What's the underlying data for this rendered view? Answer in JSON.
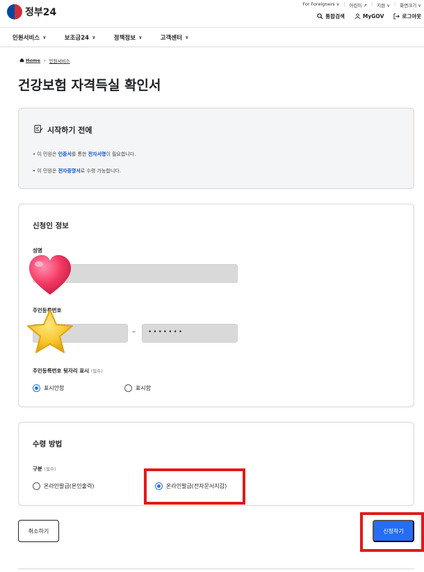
{
  "header": {
    "logo_text": "정부24",
    "util_links": [
      "For Foreigners ∨",
      "어린이 ↗",
      "지원 ∨",
      "화면크기 ∨"
    ],
    "search_label": "통합검색",
    "mygov_label": "MyGOV",
    "logout_label": "로그아웃"
  },
  "gnb": {
    "items": [
      "민원서비스",
      "보조금24",
      "정책정보",
      "고객센터"
    ]
  },
  "breadcrumb": {
    "home": "Home",
    "current": "민원서비스"
  },
  "page_title": "건강보험 자격득실 확인서",
  "notice": {
    "title": "시작하기 전에",
    "line1_pre": "• 이 민원은 ",
    "line1_b1": "인증서",
    "line1_mid": "를 통한 ",
    "line1_b2": "전자서명",
    "line1_post": "이 필요합니다.",
    "line2_pre": "• 이 민원은 ",
    "line2_b1": "전자증명서",
    "line2_post": "로 수령 가능합니다."
  },
  "applicant": {
    "title": "신청인 정보",
    "name_label": "성명",
    "rrn_label": "주민등록번호",
    "rrn_back_value": "•••••••",
    "rrn_dash": "–",
    "display_label": "주민등록번호 뒷자리 표시",
    "required": "(필수)",
    "option_hide": "표시안함",
    "option_show": "표시함"
  },
  "receive": {
    "title": "수령 방법",
    "type_label": "구분",
    "required": "(필수)",
    "option_print": "온라인발급(본인출력)",
    "option_wallet": "온라인발급(전자문서지갑)"
  },
  "buttons": {
    "cancel": "취소하기",
    "submit": "신청하기"
  },
  "colors": {
    "accent": "#256ef4",
    "highlight": "#e01a1a"
  }
}
